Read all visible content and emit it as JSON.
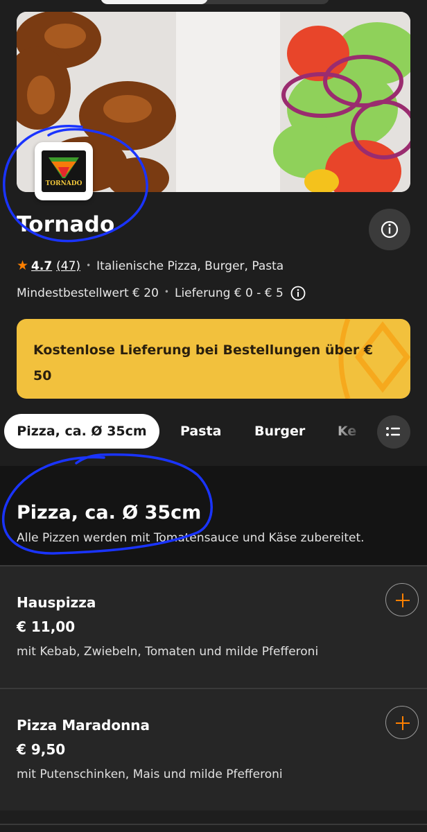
{
  "restaurant": {
    "name": "Tornado",
    "logo_text": "TORNADO",
    "rating": "4.7",
    "review_count": "(47)",
    "cuisines": "Italienische Pizza, Burger, Pasta",
    "min_order": "Mindestbestellwert € 20",
    "delivery": "Lieferung € 0 - € 5"
  },
  "banner": {
    "text": "Kostenlose Lieferung bei Bestellungen über € 50"
  },
  "tabs": [
    {
      "label": "Pizza, ca. Ø 35cm",
      "active": true
    },
    {
      "label": "Pasta"
    },
    {
      "label": "Burger"
    },
    {
      "label": "Ke"
    }
  ],
  "section": {
    "title": "Pizza, ca. Ø 35cm",
    "description": "Alle Pizzen werden mit Tomatensauce und Käse zubereitet."
  },
  "items": [
    {
      "name": "Hauspizza",
      "price": "€ 11,00",
      "description": "mit Kebab, Zwiebeln, Tomaten und milde Pfefferoni"
    },
    {
      "name": "Pizza Maradonna",
      "price": "€ 9,50",
      "description": "mit Putenschinken, Mais und milde Pfefferoni"
    }
  ],
  "colors": {
    "background": "#1e1e1e",
    "banner": "#f2c13d",
    "accent_orange": "#ff8000",
    "annotation_blue": "#1a34ff"
  },
  "icons": [
    "star-icon",
    "info-icon",
    "list-icon",
    "plus-icon"
  ]
}
